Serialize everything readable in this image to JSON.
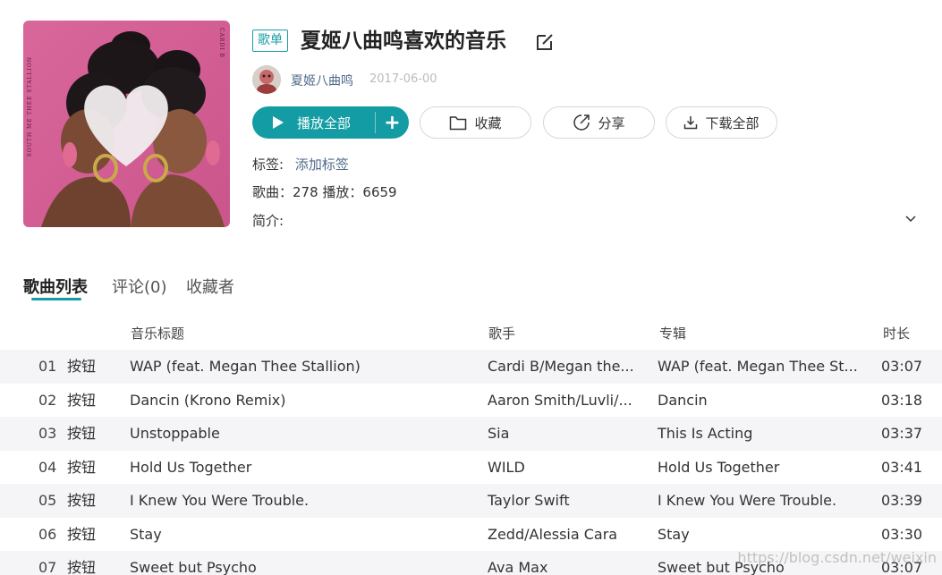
{
  "cover": {
    "side_text_left": "SOUTH ME THEE STALLION",
    "side_text_right": "CARDI B"
  },
  "header": {
    "badge": "歌单",
    "title": "夏姬八曲鸣喜欢的音乐",
    "creator": "夏姬八曲鸣",
    "date": "2017-06-00"
  },
  "actions": {
    "play_all": "播放全部",
    "add": "+",
    "collect": "收藏",
    "share": "分享",
    "download_all": "下载全部"
  },
  "meta": {
    "tags_label": "标签:",
    "tags_link": "添加标签",
    "stats": "歌曲：278  播放：6659",
    "intro_label": "简介:"
  },
  "tabs": [
    {
      "label": "歌曲列表"
    },
    {
      "label": "评论(0)"
    },
    {
      "label": "收藏者"
    }
  ],
  "table": {
    "headers": {
      "title": "音乐标题",
      "artist": "歌手",
      "album": "专辑",
      "duration": "时长"
    },
    "rows": [
      {
        "index": "01",
        "btn": "按钮",
        "title": "WAP (feat. Megan Thee Stallion)",
        "artist": "Cardi B/Megan the...",
        "album": "WAP (feat. Megan Thee St...",
        "duration": "03:07"
      },
      {
        "index": "02",
        "btn": "按钮",
        "title": "Dancin (Krono Remix)",
        "artist": "Aaron Smith/Luvli/...",
        "album": "Dancin",
        "duration": "03:18"
      },
      {
        "index": "03",
        "btn": "按钮",
        "title": "Unstoppable",
        "artist": "Sia",
        "album": "This Is Acting",
        "duration": "03:37"
      },
      {
        "index": "04",
        "btn": "按钮",
        "title": "Hold Us Together",
        "artist": "WILD",
        "album": "Hold Us Together",
        "duration": "03:41"
      },
      {
        "index": "05",
        "btn": "按钮",
        "title": "I Knew You Were Trouble.",
        "artist": "Taylor Swift",
        "album": "I Knew You Were Trouble.",
        "duration": "03:39"
      },
      {
        "index": "06",
        "btn": "按钮",
        "title": "Stay",
        "artist": "Zedd/Alessia Cara",
        "album": "Stay",
        "duration": "03:30"
      },
      {
        "index": "07",
        "btn": "按钮",
        "title": "Sweet but Psycho",
        "artist": "Ava Max",
        "album": "Sweet but Psycho",
        "duration": "03:07"
      }
    ]
  },
  "watermark": "https://blog.csdn.net/weixin",
  "colors": {
    "accent": "#139ca3",
    "link": "#506a8a",
    "row_alt": "#f5f5f7"
  }
}
